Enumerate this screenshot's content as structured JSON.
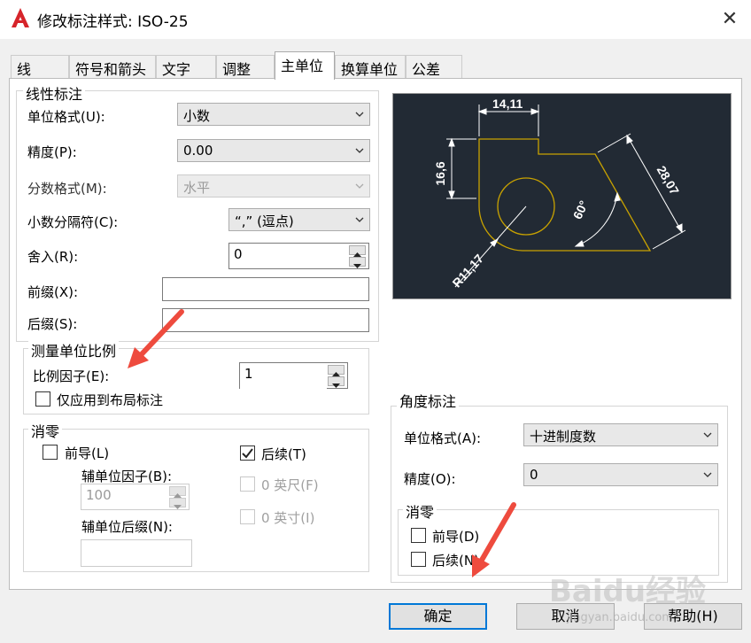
{
  "window": {
    "title": "修改标注样式: ISO-25"
  },
  "tabs": [
    "线",
    "符号和箭头",
    "文字",
    "调整",
    "主单位",
    "换算单位",
    "公差"
  ],
  "linear": {
    "legend": "线性标注",
    "unit_format_label": "单位格式(U):",
    "unit_format_value": "小数",
    "precision_label": "精度(P):",
    "precision_value": "0.00",
    "fraction_label": "分数格式(M):",
    "fraction_value": "水平",
    "decimal_sep_label": "小数分隔符(C):",
    "decimal_sep_value": "“,” (逗点)",
    "round_label": "舍入(R):",
    "round_value": "0",
    "prefix_label": "前缀(X):",
    "prefix_value": "",
    "suffix_label": "后缀(S):",
    "suffix_value": ""
  },
  "scale": {
    "legend": "测量单位比例",
    "factor_label": "比例因子(E):",
    "factor_value": "1",
    "layout_only_label": "仅应用到布局标注"
  },
  "zero_linear": {
    "legend": "消零",
    "leading_label": "前导(L)",
    "trailing_label": "后续(T)",
    "sub_factor_label": "辅单位因子(B):",
    "sub_factor_value": "100",
    "sub_suffix_label": "辅单位后缀(N):",
    "sub_suffix_value": "",
    "feet_label": "0 英尺(F)",
    "inches_label": "0 英寸(I)"
  },
  "angular": {
    "legend": "角度标注",
    "unit_format_label": "单位格式(A):",
    "unit_format_value": "十进制度数",
    "precision_label": "精度(O):",
    "precision_value": "0",
    "zero_legend": "消零",
    "leading_label": "前导(D)",
    "trailing_label": "后续(N)"
  },
  "preview": {
    "dim_top": "14,11",
    "dim_left": "16,6",
    "dim_right": "28,07",
    "dim_angle": "60°",
    "dim_radius": "R11,17"
  },
  "buttons": {
    "ok": "确定",
    "cancel": "取消",
    "help": "帮助(H)"
  },
  "watermark": {
    "main": "Baidu经验",
    "sub": "jingyan.baidu.com"
  },
  "colors": {
    "preview_bg": "#222a34",
    "geometry": "#c8a200",
    "dims": "#ffffff",
    "arrow": "#ee4b3e",
    "focus": "#0078d7"
  }
}
